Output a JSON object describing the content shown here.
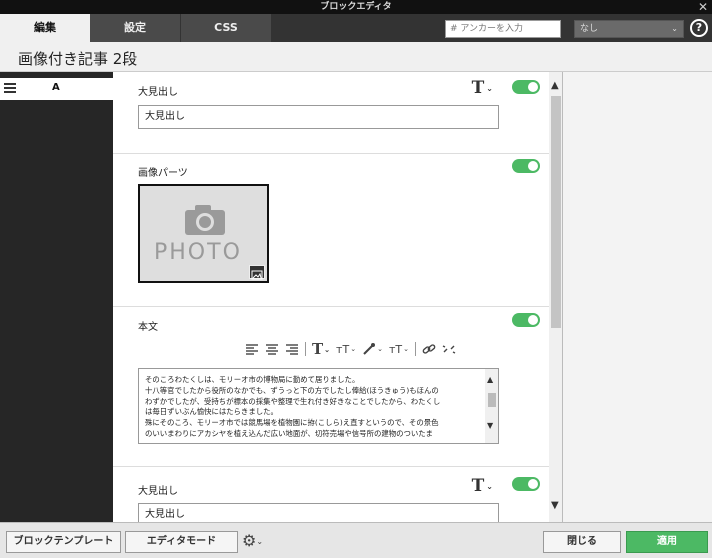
{
  "window": {
    "title": "ブロックエディタ",
    "close": "✕"
  },
  "tabs": [
    {
      "label": "編集"
    },
    {
      "label": "設定"
    },
    {
      "label": "CSS"
    }
  ],
  "anchor_input": {
    "placeholder": "# アンカーを入力"
  },
  "style_select": {
    "value": "なし"
  },
  "help": "?",
  "page_title": "画像付き記事 2段",
  "sidebar": {
    "items": [
      {
        "label": "A"
      }
    ]
  },
  "blocks": {
    "heading1": {
      "label": "大見出し",
      "value": "大見出し"
    },
    "image": {
      "label": "画像パーツ",
      "photo_text": "PHOTO"
    },
    "body": {
      "label": "本文",
      "text": "そのころわたくしは、モリーオ市の博物局に勤めて居りました。\n十八等官でしたから役所のなかでも、ずうっと下の方でしたし俸給(ほうきゅう)もほんの\nわずかでしたが、受持ちが標本の採集や整理で生れ付き好きなことでしたから、わたくし\nは毎日ずいぶん愉快にはたらきました。\n殊にそのころ、モリーオ市では競馬場を植物園に拵(こしら)え直すというので、その景色\nのいいまわりにアカシヤを植え込んだ広い地面が、切符売場や信号所の建物のついたま"
    },
    "heading2": {
      "label": "大見出し",
      "value": "大見出し"
    }
  },
  "bottom": {
    "block_template": "ブロックテンプレート",
    "editor_mode": "エディタモード",
    "close": "閉じる",
    "apply": "適用"
  },
  "colors": {
    "toggle_on": "#4cb964",
    "apply": "#4cb964"
  }
}
